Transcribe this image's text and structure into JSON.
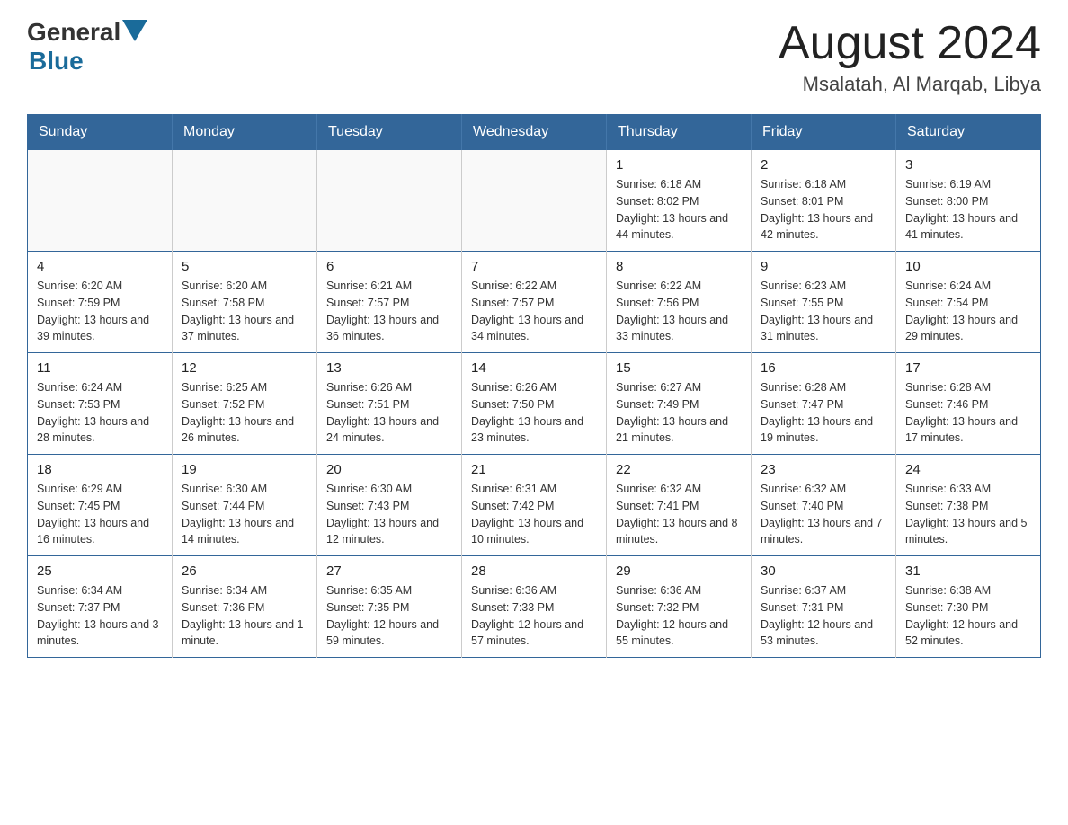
{
  "logo": {
    "general": "General",
    "blue": "Blue"
  },
  "title": "August 2024",
  "subtitle": "Msalatah, Al Marqab, Libya",
  "days_header": [
    "Sunday",
    "Monday",
    "Tuesday",
    "Wednesday",
    "Thursday",
    "Friday",
    "Saturday"
  ],
  "weeks": [
    [
      {
        "day": "",
        "info": ""
      },
      {
        "day": "",
        "info": ""
      },
      {
        "day": "",
        "info": ""
      },
      {
        "day": "",
        "info": ""
      },
      {
        "day": "1",
        "info": "Sunrise: 6:18 AM\nSunset: 8:02 PM\nDaylight: 13 hours and 44 minutes."
      },
      {
        "day": "2",
        "info": "Sunrise: 6:18 AM\nSunset: 8:01 PM\nDaylight: 13 hours and 42 minutes."
      },
      {
        "day": "3",
        "info": "Sunrise: 6:19 AM\nSunset: 8:00 PM\nDaylight: 13 hours and 41 minutes."
      }
    ],
    [
      {
        "day": "4",
        "info": "Sunrise: 6:20 AM\nSunset: 7:59 PM\nDaylight: 13 hours and 39 minutes."
      },
      {
        "day": "5",
        "info": "Sunrise: 6:20 AM\nSunset: 7:58 PM\nDaylight: 13 hours and 37 minutes."
      },
      {
        "day": "6",
        "info": "Sunrise: 6:21 AM\nSunset: 7:57 PM\nDaylight: 13 hours and 36 minutes."
      },
      {
        "day": "7",
        "info": "Sunrise: 6:22 AM\nSunset: 7:57 PM\nDaylight: 13 hours and 34 minutes."
      },
      {
        "day": "8",
        "info": "Sunrise: 6:22 AM\nSunset: 7:56 PM\nDaylight: 13 hours and 33 minutes."
      },
      {
        "day": "9",
        "info": "Sunrise: 6:23 AM\nSunset: 7:55 PM\nDaylight: 13 hours and 31 minutes."
      },
      {
        "day": "10",
        "info": "Sunrise: 6:24 AM\nSunset: 7:54 PM\nDaylight: 13 hours and 29 minutes."
      }
    ],
    [
      {
        "day": "11",
        "info": "Sunrise: 6:24 AM\nSunset: 7:53 PM\nDaylight: 13 hours and 28 minutes."
      },
      {
        "day": "12",
        "info": "Sunrise: 6:25 AM\nSunset: 7:52 PM\nDaylight: 13 hours and 26 minutes."
      },
      {
        "day": "13",
        "info": "Sunrise: 6:26 AM\nSunset: 7:51 PM\nDaylight: 13 hours and 24 minutes."
      },
      {
        "day": "14",
        "info": "Sunrise: 6:26 AM\nSunset: 7:50 PM\nDaylight: 13 hours and 23 minutes."
      },
      {
        "day": "15",
        "info": "Sunrise: 6:27 AM\nSunset: 7:49 PM\nDaylight: 13 hours and 21 minutes."
      },
      {
        "day": "16",
        "info": "Sunrise: 6:28 AM\nSunset: 7:47 PM\nDaylight: 13 hours and 19 minutes."
      },
      {
        "day": "17",
        "info": "Sunrise: 6:28 AM\nSunset: 7:46 PM\nDaylight: 13 hours and 17 minutes."
      }
    ],
    [
      {
        "day": "18",
        "info": "Sunrise: 6:29 AM\nSunset: 7:45 PM\nDaylight: 13 hours and 16 minutes."
      },
      {
        "day": "19",
        "info": "Sunrise: 6:30 AM\nSunset: 7:44 PM\nDaylight: 13 hours and 14 minutes."
      },
      {
        "day": "20",
        "info": "Sunrise: 6:30 AM\nSunset: 7:43 PM\nDaylight: 13 hours and 12 minutes."
      },
      {
        "day": "21",
        "info": "Sunrise: 6:31 AM\nSunset: 7:42 PM\nDaylight: 13 hours and 10 minutes."
      },
      {
        "day": "22",
        "info": "Sunrise: 6:32 AM\nSunset: 7:41 PM\nDaylight: 13 hours and 8 minutes."
      },
      {
        "day": "23",
        "info": "Sunrise: 6:32 AM\nSunset: 7:40 PM\nDaylight: 13 hours and 7 minutes."
      },
      {
        "day": "24",
        "info": "Sunrise: 6:33 AM\nSunset: 7:38 PM\nDaylight: 13 hours and 5 minutes."
      }
    ],
    [
      {
        "day": "25",
        "info": "Sunrise: 6:34 AM\nSunset: 7:37 PM\nDaylight: 13 hours and 3 minutes."
      },
      {
        "day": "26",
        "info": "Sunrise: 6:34 AM\nSunset: 7:36 PM\nDaylight: 13 hours and 1 minute."
      },
      {
        "day": "27",
        "info": "Sunrise: 6:35 AM\nSunset: 7:35 PM\nDaylight: 12 hours and 59 minutes."
      },
      {
        "day": "28",
        "info": "Sunrise: 6:36 AM\nSunset: 7:33 PM\nDaylight: 12 hours and 57 minutes."
      },
      {
        "day": "29",
        "info": "Sunrise: 6:36 AM\nSunset: 7:32 PM\nDaylight: 12 hours and 55 minutes."
      },
      {
        "day": "30",
        "info": "Sunrise: 6:37 AM\nSunset: 7:31 PM\nDaylight: 12 hours and 53 minutes."
      },
      {
        "day": "31",
        "info": "Sunrise: 6:38 AM\nSunset: 7:30 PM\nDaylight: 12 hours and 52 minutes."
      }
    ]
  ]
}
